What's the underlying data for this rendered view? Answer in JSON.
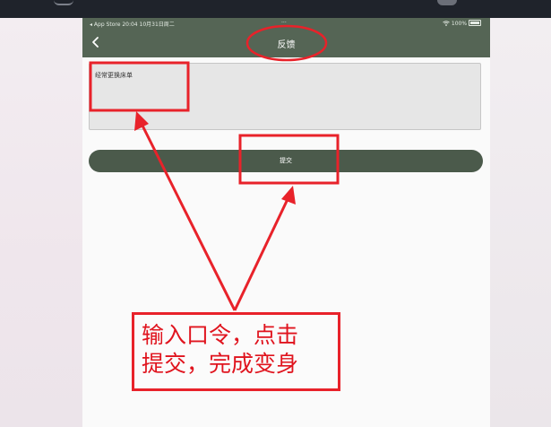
{
  "status_bar": {
    "left": "◂ App Store  20:04  10月31日周二",
    "center": "···",
    "battery": "100%"
  },
  "nav": {
    "title": "反馈"
  },
  "feedback": {
    "value": "经常更换床单"
  },
  "submit": {
    "label": "提交"
  },
  "annotation": {
    "line1": "输入口令，点击",
    "line2": "提交，完成变身"
  },
  "colors": {
    "header": "#556555",
    "submit_button": "#4b5a4b",
    "annotation_red": "#e8222a",
    "input_bg": "#e6e6e6"
  },
  "icons": [
    "back-chevron-icon",
    "wifi-icon",
    "battery-icon"
  ]
}
